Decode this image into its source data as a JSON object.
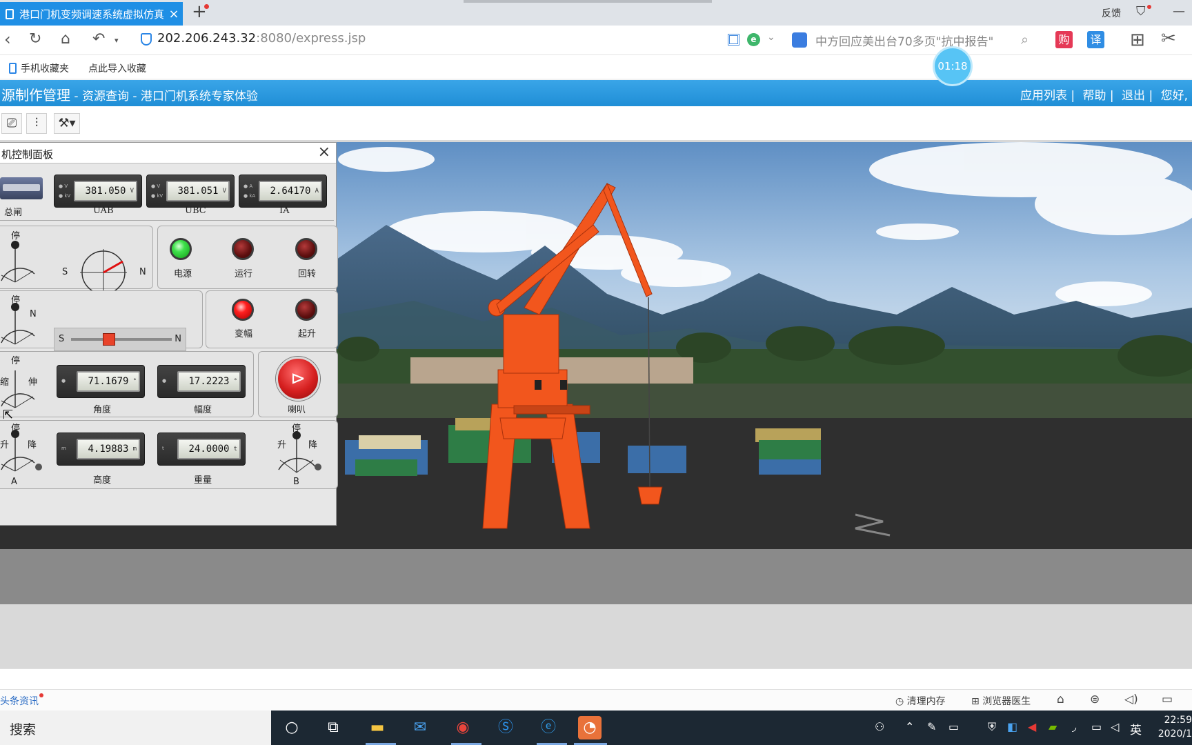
{
  "browser": {
    "tab_title": "港口门机变频调速系统虚拟仿真",
    "tab_close": "×",
    "new_tab": "+",
    "feedback": "反馈",
    "url_host": "202.206.243.32",
    "url_rest": ":8080/express.jsp",
    "search_text": "中方回应美出台70多页\"抗中报告\"",
    "gou": "购",
    "yi": "译",
    "bookmark_mobile": "手机收藏夹",
    "bookmark_import": "点此导入收藏",
    "timer": "01:18"
  },
  "app": {
    "title": "源制作管理",
    "crumb1": "资源查询",
    "crumb2": "港口门机系统专家体验",
    "sep": " - ",
    "links": [
      "应用列表 |",
      "帮助 |",
      "退出 |",
      "您好,"
    ]
  },
  "panel": {
    "title": "机控制面板",
    "close": "×",
    "main_switch_label": "总闸",
    "meters": {
      "uab": {
        "value": "381.050",
        "unit": "V",
        "label": "UAB"
      },
      "ubc": {
        "value": "381.051",
        "unit": "V",
        "label": "UBC"
      },
      "ia": {
        "value": "2.64170",
        "unit": "A",
        "label": "IA"
      },
      "angle": {
        "value": "71.1679",
        "unit": "°",
        "label": "角度"
      },
      "amplitude": {
        "value": "17.2223",
        "unit": "°",
        "label": "幅度"
      },
      "height": {
        "value": "4.19883",
        "unit": "m",
        "label": "高度"
      },
      "weight": {
        "value": "24.0000",
        "unit": "t",
        "label": "重量"
      }
    },
    "knob_labels": {
      "stop": "停",
      "n": "N",
      "s": "S",
      "retract": "缩",
      "extend": "伸",
      "raise": "升",
      "lower": "降",
      "a": "A",
      "b": "B"
    },
    "slider": {
      "left": "S",
      "right": "N",
      "value": 0.38
    },
    "lamps": {
      "power": "电源",
      "run": "运行",
      "slew": "回转",
      "luff": "变幅",
      "hoist": "起升"
    },
    "horn_label": "喇叭"
  },
  "statusbar": {
    "news": "头条资讯",
    "clean_memory": "清理内存",
    "browser_doctor": "浏览器医生"
  },
  "taskbar": {
    "search": "搜索",
    "ime": "英",
    "time": "22:59",
    "date": "2020/1"
  },
  "colors": {
    "accent": "#1f8fe5",
    "crane": "#f2561d",
    "lamp_green": "#3fe04b",
    "lamp_red": "#ff2020"
  }
}
